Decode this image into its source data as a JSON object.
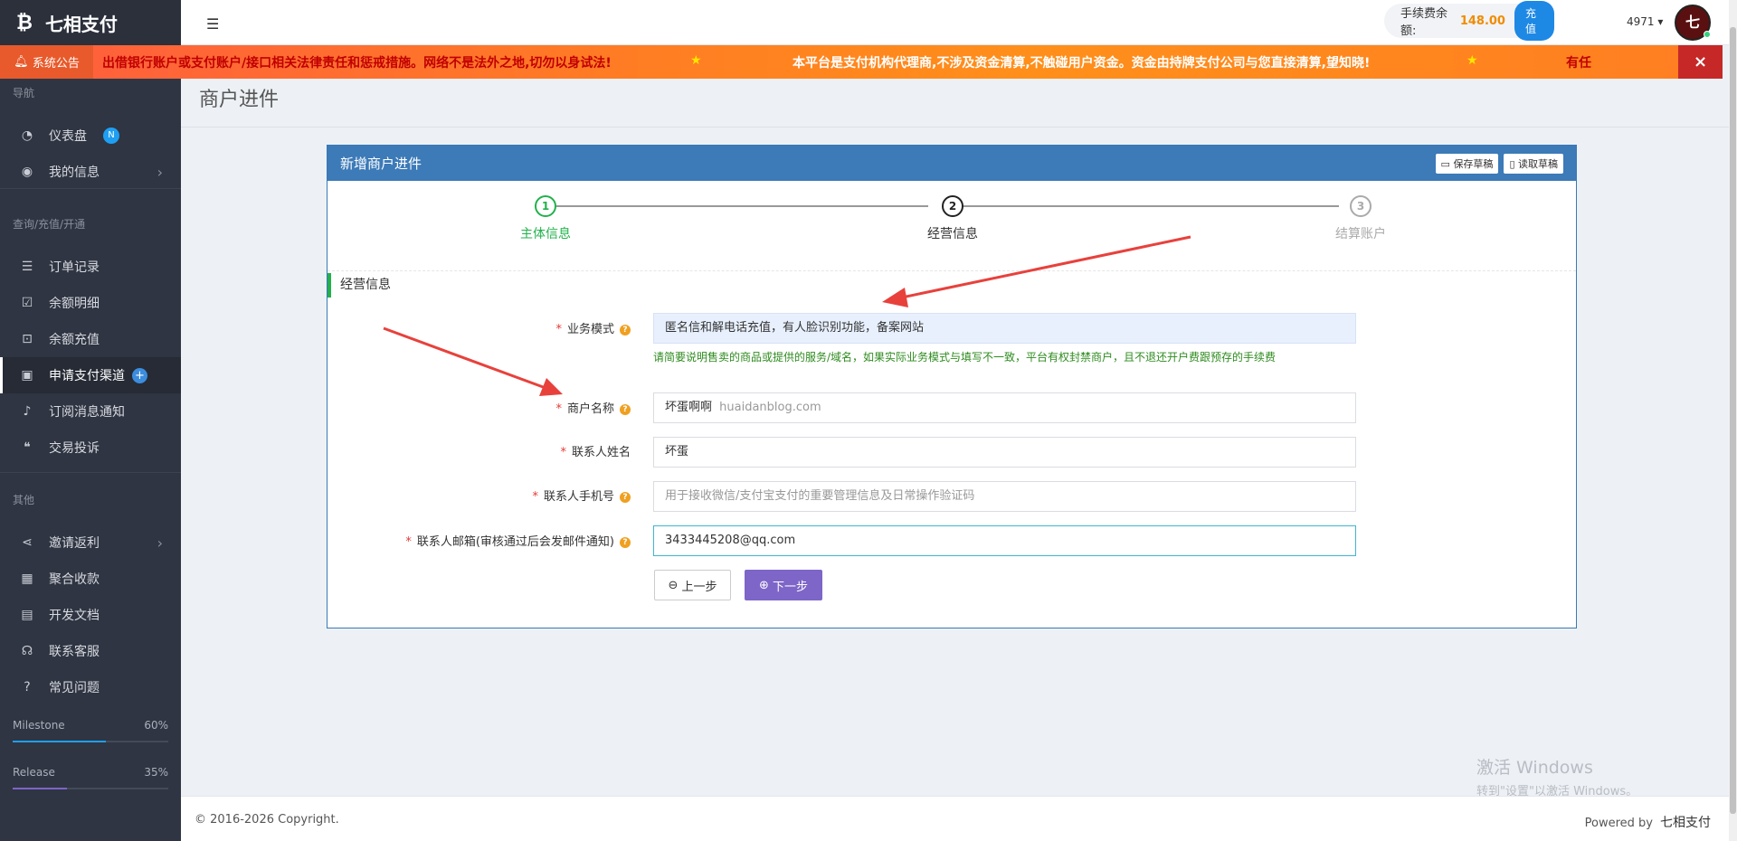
{
  "brand": {
    "logo": "₿",
    "name": "七相支付"
  },
  "sidebar": {
    "sections": [
      "导航",
      "查询/充值/开通",
      "其他"
    ],
    "items": [
      {
        "label": "仪表盘",
        "icon": "dashboard-icon",
        "badge": "N"
      },
      {
        "label": "我的信息",
        "icon": "user-circle-icon"
      },
      {
        "label": "订单记录",
        "icon": "list-icon"
      },
      {
        "label": "余额明细",
        "icon": "calendar-check-icon"
      },
      {
        "label": "余额充值",
        "icon": "money-icon"
      },
      {
        "label": "申请支付渠道",
        "icon": "file-icon",
        "badge": "+"
      },
      {
        "label": "订阅消息通知",
        "icon": "bell-icon"
      },
      {
        "label": "交易投诉",
        "icon": "comments-icon"
      },
      {
        "label": "邀请返利",
        "icon": "share-icon"
      },
      {
        "label": "聚合收款",
        "icon": "qrcode-icon"
      },
      {
        "label": "开发文档",
        "icon": "book-icon"
      },
      {
        "label": "联系客服",
        "icon": "headset-icon"
      },
      {
        "label": "常见问题",
        "icon": "question-icon"
      }
    ],
    "progress": [
      {
        "label": "Milestone",
        "value": "60%",
        "fraction": 0.6,
        "color": "#1e9ff2"
      },
      {
        "label": "Release",
        "value": "35%",
        "fraction": 0.35,
        "color": "#7e65c8"
      }
    ]
  },
  "topbar": {
    "fee_label": "手续费余额:",
    "fee_amount": "148.00",
    "recharge_label": "充值",
    "user_id": "4971",
    "avatar_text": "七"
  },
  "notice": {
    "title": "系统公告",
    "text1": "出借银行账户或支付账户/接口相关法律责任和惩戒措施。网络不是法外之地,切勿以身试法!",
    "star": "★",
    "text2": "本平台是支付机构代理商,不涉及资金清算,不触碰用户资金。资金由持牌支付公司与您直接清算,望知晓!",
    "text3": "有任",
    "close": "×"
  },
  "page": {
    "title": "商户进件"
  },
  "panel": {
    "title": "新增商户进件",
    "save_draft": "保存草稿",
    "load_draft": "读取草稿",
    "steps": [
      {
        "num": "1",
        "label": "主体信息",
        "state": "done"
      },
      {
        "num": "2",
        "label": "经营信息",
        "state": "active"
      },
      {
        "num": "3",
        "label": "结算账户",
        "state": "todo"
      }
    ],
    "section": "经营信息"
  },
  "form": {
    "business_mode": {
      "label": "业务模式",
      "value": "匿名信和解电话充值，有人脸识别功能，备案网站"
    },
    "business_hint": "请简要说明售卖的商品或提供的服务/域名，如果实际业务模式与填写不一致，平台有权封禁商户，且不退还开户费跟预存的手续费",
    "merchant_name": {
      "label": "商户名称",
      "value": "坏蛋啊啊",
      "watermark": "huaidanblog.com"
    },
    "contact_name": {
      "label": "联系人姓名",
      "value": "坏蛋"
    },
    "contact_phone": {
      "label": "联系人手机号",
      "placeholder": "用于接收微信/支付宝支付的重要管理信息及日常操作验证码"
    },
    "contact_email": {
      "label": "联系人邮箱(审核通过后会发邮件通知)",
      "value": "3433445208@qq.com"
    },
    "prev_button": "上一步",
    "next_button": "下一步"
  },
  "footer": {
    "copyright": "© 2016-2026 Copyright.",
    "powered": "Powered by",
    "powered_brand": "七相支付"
  },
  "windows_watermark": {
    "line1": "激活 Windows",
    "line2": "转到\"设置\"以激活 Windows。"
  }
}
